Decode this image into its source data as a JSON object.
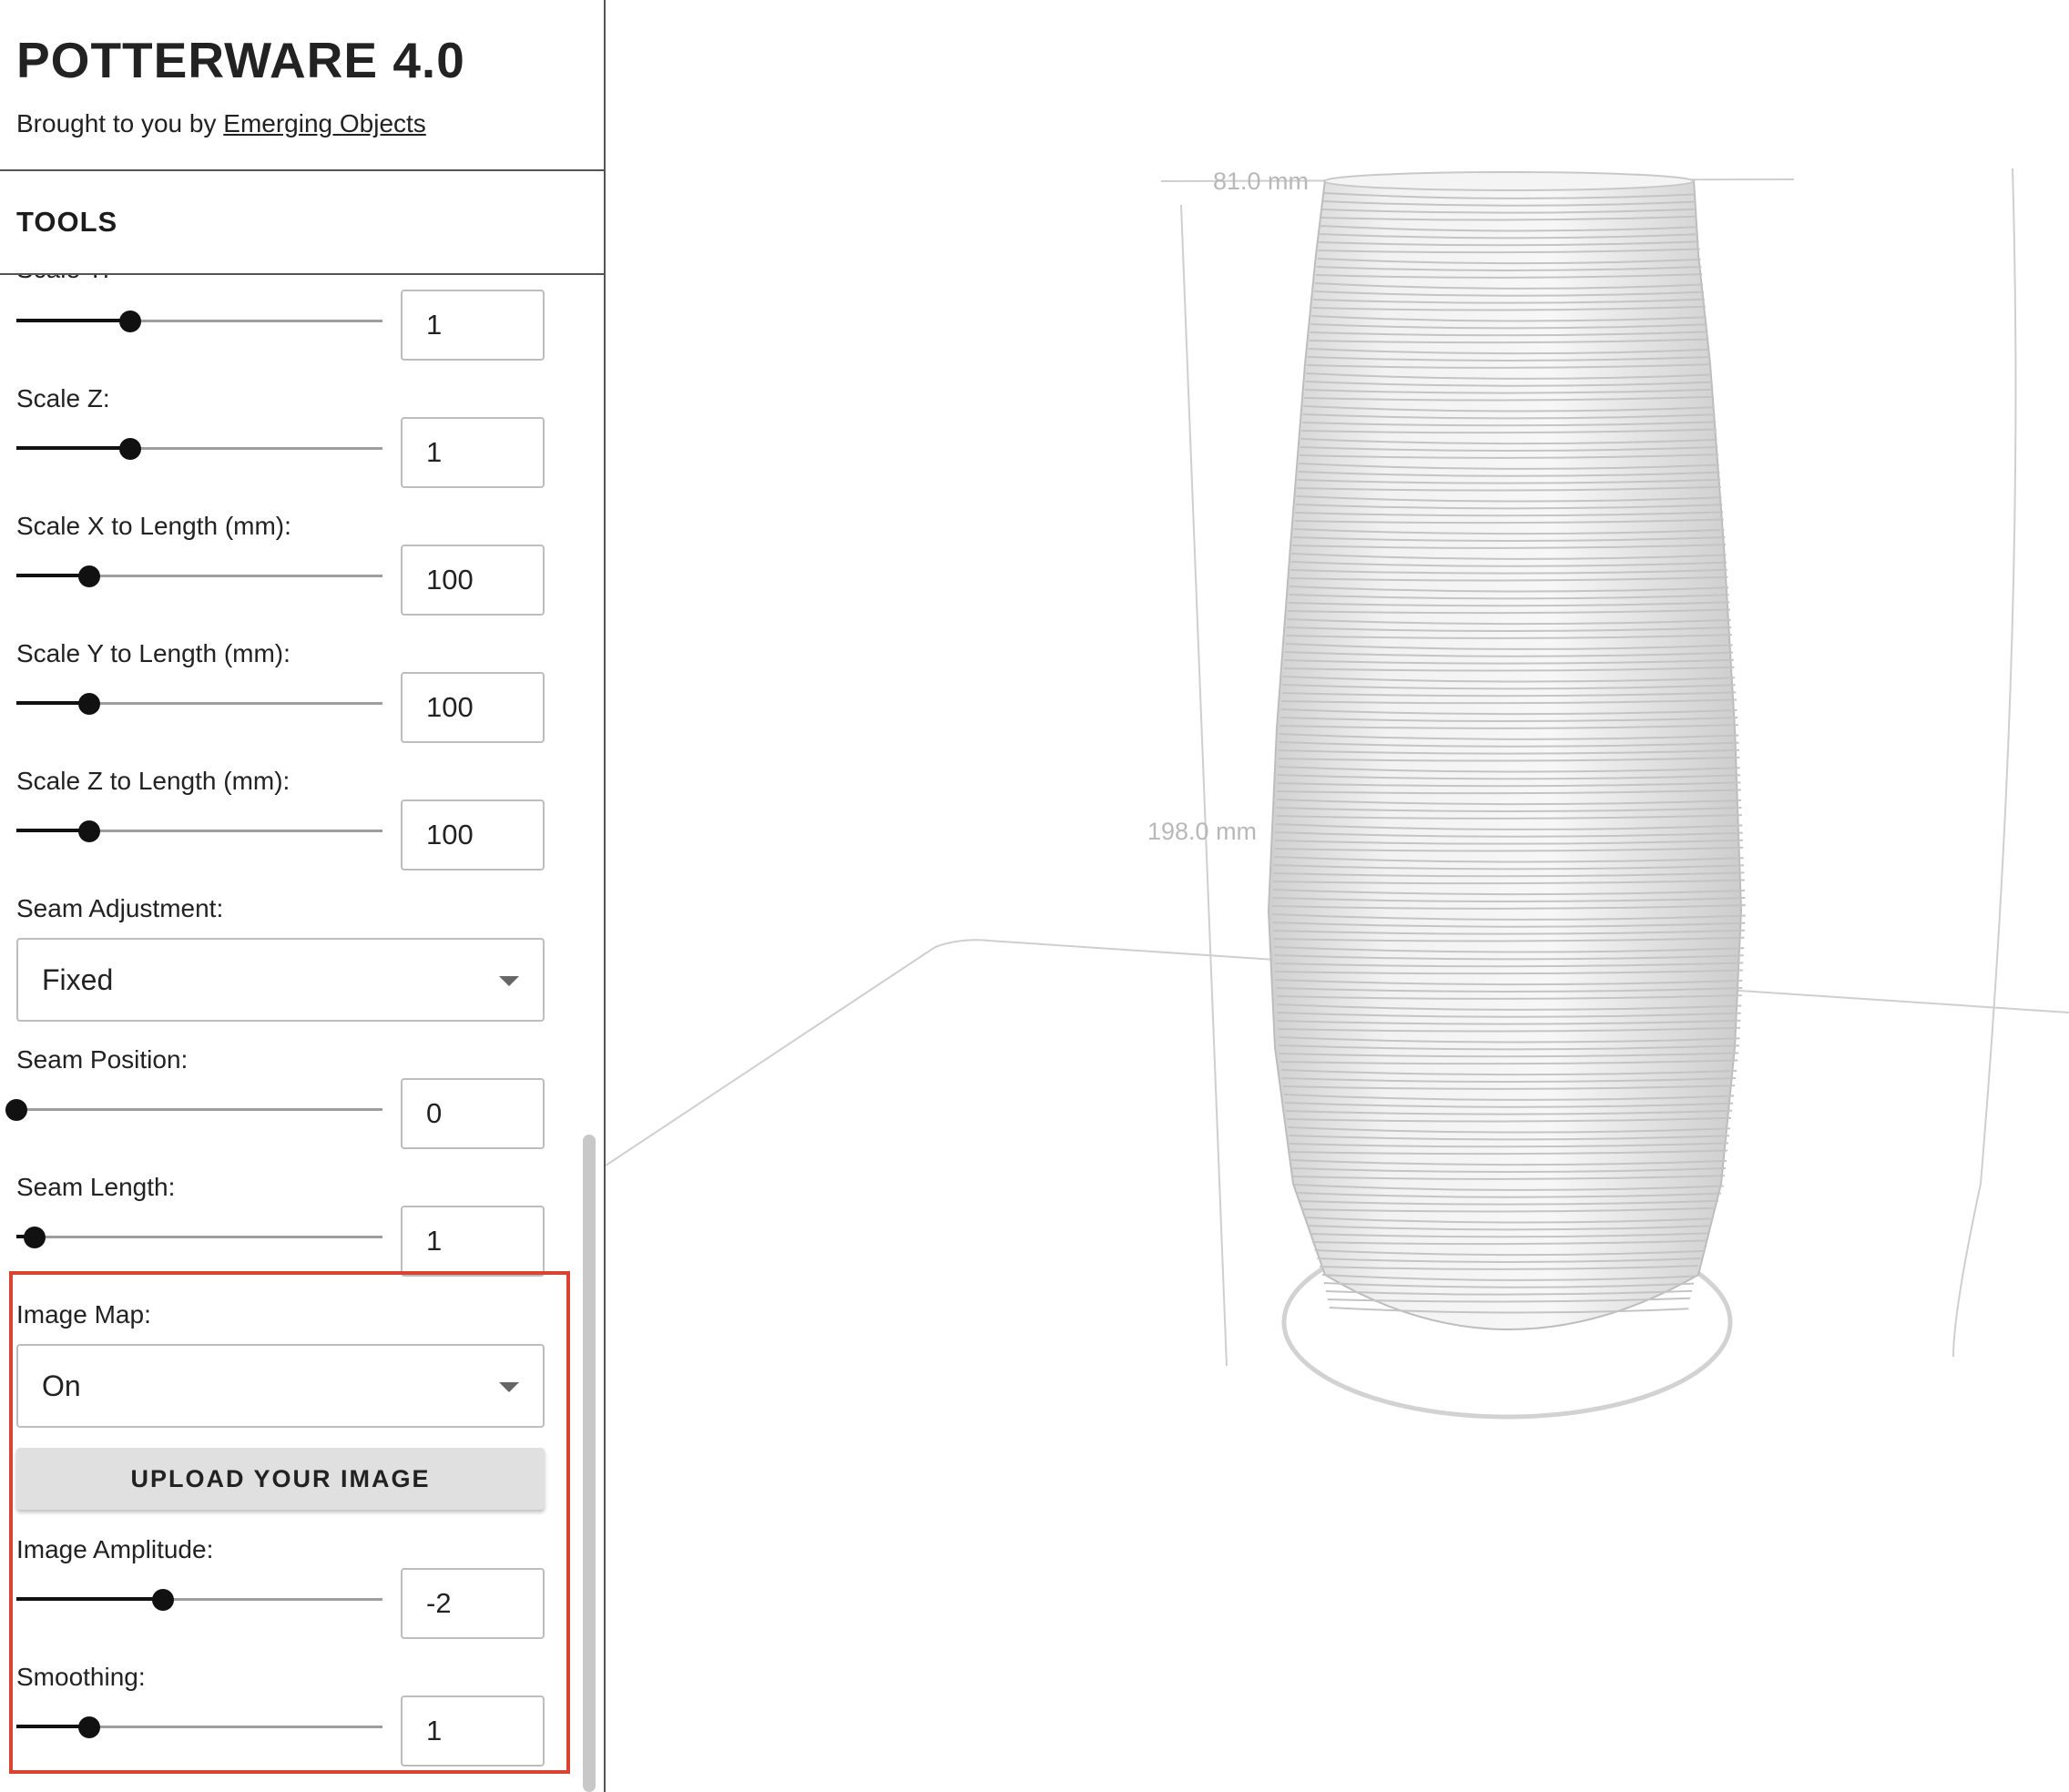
{
  "app": {
    "title": "POTTERWARE 4.0",
    "byline_prefix": "Brought to you by",
    "byline_link": "Emerging Objects"
  },
  "tools": {
    "title": "TOOLS",
    "partial_label": "Scale Y:",
    "controls": {
      "scale_y": {
        "value": "1",
        "slider_fraction": 0.31
      },
      "scale_z": {
        "label": "Scale Z:",
        "value": "1",
        "slider_fraction": 0.31
      },
      "scale_x_len": {
        "label": "Scale X to Length (mm):",
        "value": "100",
        "slider_fraction": 0.2
      },
      "scale_y_len": {
        "label": "Scale Y to Length (mm):",
        "value": "100",
        "slider_fraction": 0.2
      },
      "scale_z_len": {
        "label": "Scale Z to Length (mm):",
        "value": "100",
        "slider_fraction": 0.2
      },
      "seam_adjustment": {
        "label": "Seam Adjustment:",
        "selected": "Fixed"
      },
      "seam_position": {
        "label": "Seam Position:",
        "value": "0",
        "slider_fraction": 0.0
      },
      "seam_length": {
        "label": "Seam Length:",
        "value": "1",
        "slider_fraction": 0.05
      },
      "image_map": {
        "label": "Image Map:",
        "selected": "On"
      },
      "upload_button": "UPLOAD YOUR IMAGE",
      "image_amplitude": {
        "label": "Image Amplitude:",
        "value": "-2",
        "slider_fraction": 0.4
      },
      "smoothing": {
        "label": "Smoothing:",
        "value": "1",
        "slider_fraction": 0.2
      }
    }
  },
  "viewport": {
    "width_dim": "81.0 mm",
    "height_dim": "198.0 mm",
    "model_color": "#efefef",
    "highlight_color": "#d9432f"
  }
}
